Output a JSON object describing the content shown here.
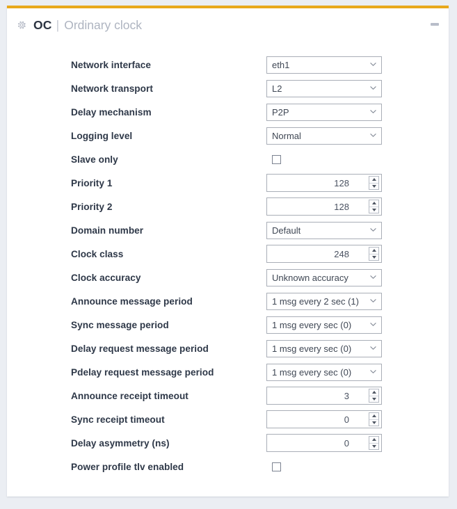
{
  "header": {
    "gear_icon": "gear-icon",
    "code": "OC",
    "separator": "|",
    "name": "Ordinary clock",
    "minimize_icon": "minimize-icon"
  },
  "form": {
    "rows": [
      {
        "label": "Network interface",
        "type": "select",
        "value": "eth1"
      },
      {
        "label": "Network transport",
        "type": "select",
        "value": "L2"
      },
      {
        "label": "Delay mechanism",
        "type": "select",
        "value": "P2P"
      },
      {
        "label": "Logging level",
        "type": "select",
        "value": "Normal"
      },
      {
        "label": "Slave only",
        "type": "checkbox",
        "value": "unchecked"
      },
      {
        "label": "Priority 1",
        "type": "spinner",
        "value": "128"
      },
      {
        "label": "Priority 2",
        "type": "spinner",
        "value": "128"
      },
      {
        "label": "Domain number",
        "type": "select",
        "value": "Default"
      },
      {
        "label": "Clock class",
        "type": "spinner",
        "value": "248"
      },
      {
        "label": "Clock accuracy",
        "type": "select",
        "value": "Unknown accuracy"
      },
      {
        "label": "Announce message period",
        "type": "select",
        "value": "1 msg every 2 sec (1)"
      },
      {
        "label": "Sync message period",
        "type": "select",
        "value": "1 msg every sec (0)"
      },
      {
        "label": "Delay request message period",
        "type": "select",
        "value": "1 msg every sec (0)"
      },
      {
        "label": "Pdelay request message period",
        "type": "select",
        "value": "1 msg every sec (0)"
      },
      {
        "label": "Announce receipt timeout",
        "type": "spinner",
        "value": "3"
      },
      {
        "label": "Sync receipt timeout",
        "type": "spinner",
        "value": "0"
      },
      {
        "label": "Delay asymmetry (ns)",
        "type": "spinner",
        "value": "0"
      },
      {
        "label": "Power profile tlv enabled",
        "type": "checkbox",
        "value": "unchecked"
      }
    ]
  },
  "colors": {
    "accent": "#e8a81c",
    "page_background": "#ebeef3",
    "panel_background": "#ffffff",
    "label_text": "#2e3848",
    "value_text": "#3f4754",
    "muted_text": "#aeb4c0"
  }
}
